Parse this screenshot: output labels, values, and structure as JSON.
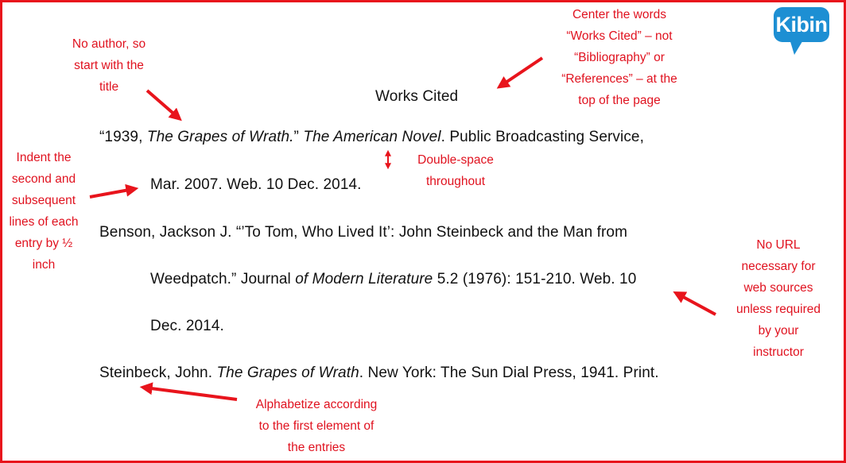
{
  "logo": {
    "text": "Kibin",
    "color": "#1d8fd3"
  },
  "colors": {
    "annotation": "#e0121f",
    "border": "#e8141c",
    "text": "#111111"
  },
  "document": {
    "heading": "Works Cited",
    "entries": [
      {
        "lines": [
          {
            "segments": [
              {
                "text": "“1939, ",
                "italic": false
              },
              {
                "text": "The Grapes of Wrath.",
                "italic": true
              },
              {
                "text": "”  ",
                "italic": false
              },
              {
                "text": "The American Novel",
                "italic": true
              },
              {
                "text": ". Public Broadcasting Service,",
                "italic": false
              }
            ]
          },
          {
            "segments": [
              {
                "text": "Mar. 2007. Web. 10 Dec. 2014.",
                "italic": false
              }
            ]
          }
        ]
      },
      {
        "lines": [
          {
            "segments": [
              {
                "text": "Benson, Jackson J. “’To Tom, Who Lived It’: John Steinbeck and the Man from",
                "italic": false
              }
            ]
          },
          {
            "segments": [
              {
                "text": "Weedpatch.” Journal ",
                "italic": false
              },
              {
                "text": "of Modern Literature",
                "italic": true
              },
              {
                "text": " 5.2 (1976): 151-210. Web. 10",
                "italic": false
              }
            ]
          },
          {
            "segments": [
              {
                "text": "Dec. 2014.",
                "italic": false
              }
            ]
          }
        ]
      },
      {
        "lines": [
          {
            "segments": [
              {
                "text": "Steinbeck, John. ",
                "italic": false
              },
              {
                "text": "The Grapes of Wrath",
                "italic": true
              },
              {
                "text": ".  New York: The Sun Dial Press, 1941. Print.",
                "italic": false
              }
            ]
          }
        ]
      }
    ]
  },
  "annotations": {
    "no_author": [
      "No author, so",
      "start with the",
      "title"
    ],
    "center_heading": [
      "Center the words",
      "“Works Cited” – not",
      "“Bibliography” or",
      "“References” – at the",
      "top of the page"
    ],
    "indent": [
      "Indent the",
      "second and",
      "subsequent",
      "lines of each",
      "entry by ½",
      "inch"
    ],
    "double_space": [
      "Double-space",
      "throughout"
    ],
    "no_url": [
      "No URL",
      "necessary for",
      "web sources",
      "unless required",
      "by your",
      "instructor"
    ],
    "alphabetize": [
      "Alphabetize according",
      "to the first element  of",
      "the entries"
    ]
  }
}
